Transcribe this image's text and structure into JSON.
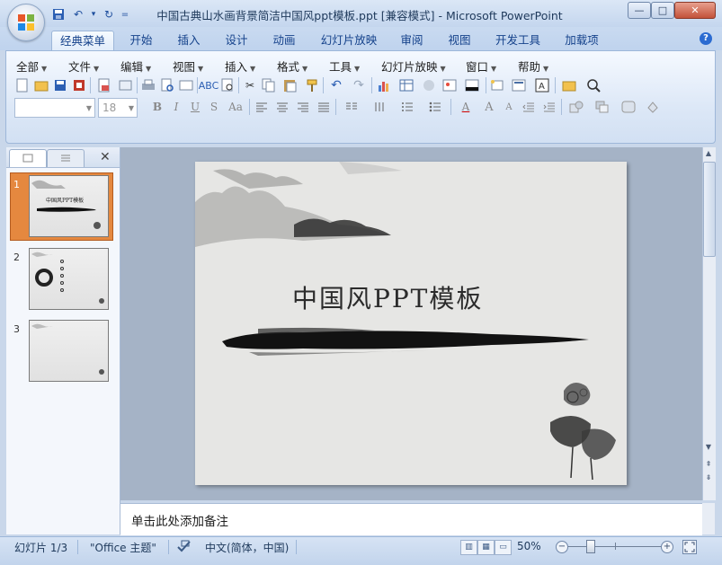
{
  "window": {
    "title": "中国古典山水画背景简洁中国风ppt模板.ppt [兼容模式] - Microsoft PowerPoint",
    "minimize_glyph": "—",
    "maximize_glyph": "□",
    "close_glyph": "✕"
  },
  "quick_access": {
    "save_glyph": "▪",
    "undo_glyph": "↶",
    "dropdown_glyph": "▾",
    "redo_glyph": "↻",
    "customize_glyph": "="
  },
  "tabs": [
    {
      "label": "经典菜单"
    },
    {
      "label": "开始"
    },
    {
      "label": "插入"
    },
    {
      "label": "设计"
    },
    {
      "label": "动画"
    },
    {
      "label": "幻灯片放映"
    },
    {
      "label": "审阅"
    },
    {
      "label": "视图"
    },
    {
      "label": "开发工具"
    },
    {
      "label": "加载项"
    }
  ],
  "help_glyph": "?",
  "menus": [
    {
      "label": "全部"
    },
    {
      "label": "文件"
    },
    {
      "label": "编辑"
    },
    {
      "label": "视图"
    },
    {
      "label": "插入"
    },
    {
      "label": "格式"
    },
    {
      "label": "工具"
    },
    {
      "label": "幻灯片放映"
    },
    {
      "label": "窗口"
    },
    {
      "label": "帮助"
    }
  ],
  "format_bar": {
    "font_size": "18",
    "bold": "B",
    "italic": "I",
    "underline": "U",
    "shadow": "S",
    "change_case": "Aa",
    "font_color": "A",
    "grow_font": "A",
    "shrink_font": "A"
  },
  "left_panel": {
    "close_glyph": "✕",
    "slides": [
      {
        "num": "1"
      },
      {
        "num": "2"
      },
      {
        "num": "3"
      }
    ],
    "thumb1_title": "中国风PPT模板"
  },
  "slide": {
    "title": "中国风PPT模板"
  },
  "notes": {
    "placeholder": "单击此处添加备注"
  },
  "status": {
    "slide_position": "幻灯片 1/3",
    "theme": "\"Office 主题\"",
    "language": "中文(简体，中国)",
    "zoom": "50%",
    "zoom_out": "−",
    "zoom_in": "+"
  },
  "colors": {
    "accent": "#15428b",
    "selected_thumb": "#e5883f"
  }
}
